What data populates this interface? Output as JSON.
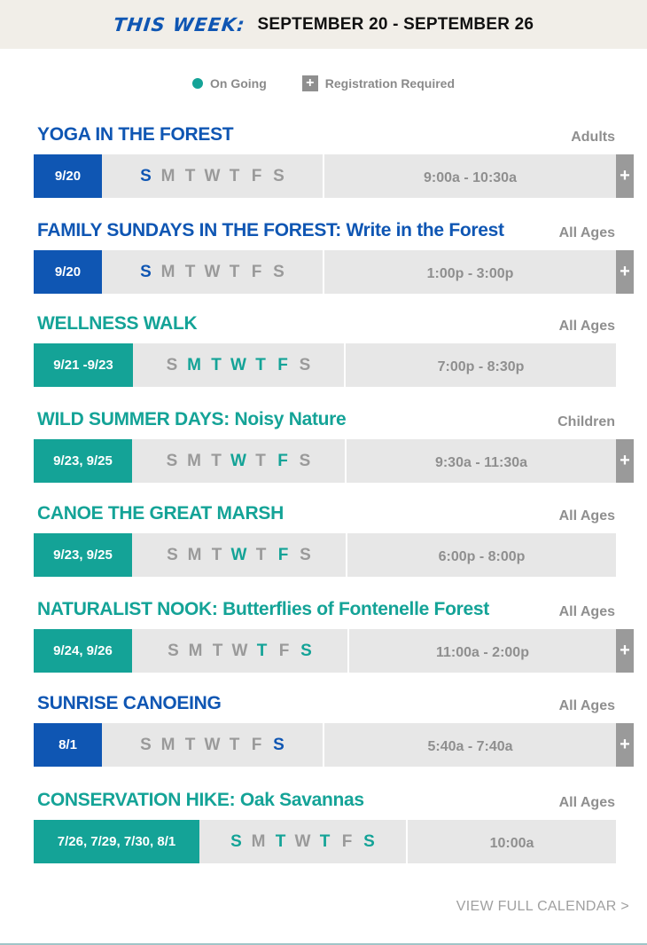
{
  "header": {
    "this_week": "THIS WEEK:",
    "range": "SEPTEMBER 20 - SEPTEMBER 26"
  },
  "legend": {
    "ongoing": "On Going",
    "registration": "Registration Required",
    "plus_symbol": "+"
  },
  "colors": {
    "blue": "#0f56b3",
    "teal": "#14a397",
    "gray": "#8f8f8f"
  },
  "events": [
    {
      "title": "YOGA IN THE FOREST",
      "audience": "Adults",
      "date": "9/20",
      "days": [
        "S",
        "M",
        "T",
        "W",
        "T",
        "F",
        "S"
      ],
      "time": "9:00a - 10:30a",
      "plus": "+"
    },
    {
      "title": "FAMILY SUNDAYS IN THE FOREST: Write in the Forest",
      "audience": "All Ages",
      "date": "9/20",
      "days": [
        "S",
        "M",
        "T",
        "W",
        "T",
        "F",
        "S"
      ],
      "time": "1:00p - 3:00p",
      "plus": "+"
    },
    {
      "title": "WELLNESS WALK",
      "audience": "All Ages",
      "date": "9/21 -9/23",
      "days": [
        "S",
        "M",
        "T",
        "W",
        "T",
        "F",
        "S"
      ],
      "time": "7:00p - 8:30p"
    },
    {
      "title": "WILD SUMMER DAYS: Noisy Nature",
      "audience": "Children",
      "date": "9/23, 9/25",
      "days": [
        "S",
        "M",
        "T",
        "W",
        "T",
        "F",
        "S"
      ],
      "time": "9:30a - 11:30a",
      "plus": "+"
    },
    {
      "title": "CANOE THE GREAT MARSH",
      "audience": "All Ages",
      "date": "9/23, 9/25",
      "days": [
        "S",
        "M",
        "T",
        "W",
        "T",
        "F",
        "S"
      ],
      "time": "6:00p - 8:00p"
    },
    {
      "title": "NATURALIST NOOK: Butterflies of Fontenelle Forest",
      "audience": "All Ages",
      "date": "9/24, 9/26",
      "days": [
        "S",
        "M",
        "T",
        "W",
        "T",
        "F",
        "S"
      ],
      "time": "11:00a - 2:00p",
      "plus": "+"
    },
    {
      "title": "SUNRISE CANOEING",
      "audience": "All Ages",
      "date": "8/1",
      "days": [
        "S",
        "M",
        "T",
        "W",
        "T",
        "F",
        "S"
      ],
      "time": "5:40a - 7:40a",
      "plus": "+"
    },
    {
      "title": "CONSERVATION HIKE: Oak Savannas",
      "audience": "All Ages",
      "date": "7/26, 7/29, 7/30, 8/1",
      "days": [
        "S",
        "M",
        "T",
        "W",
        "T",
        "F",
        "S"
      ],
      "time": "10:00a"
    }
  ],
  "footer": {
    "view_full_calendar": "VIEW FULL CALENDAR >"
  }
}
